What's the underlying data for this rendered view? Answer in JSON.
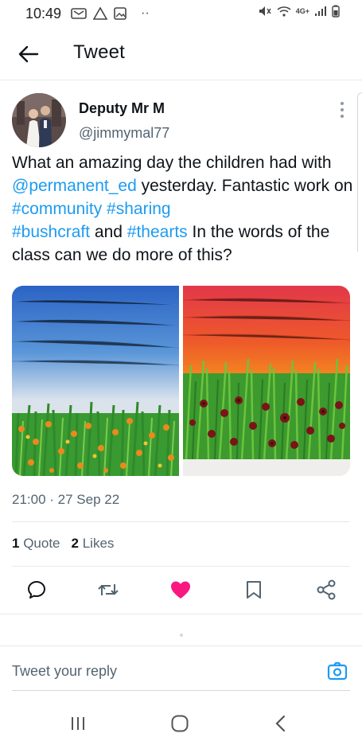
{
  "status_bar": {
    "time": "10:49",
    "dots": "··",
    "network": "4G+"
  },
  "header": {
    "title": "Tweet"
  },
  "tweet": {
    "display_name": "Deputy Mr M",
    "handle": "@jimmymal77",
    "text_parts": [
      "What an amazing day the children had with ",
      "@permanent_ed",
      " yesterday. Fantastic work on ",
      "#community",
      " ",
      "#sharing",
      " ",
      "#bushcraft",
      " and ",
      "#thearts",
      " In the words of the class can we do more of this?"
    ],
    "timestamp": "21:00 · 27 Sep 22",
    "stats": {
      "quotes_count": "1",
      "quotes_label": "Quote",
      "likes_count": "2",
      "likes_label": "Likes"
    },
    "liked": true
  },
  "reply": {
    "placeholder": "Tweet your reply"
  },
  "colors": {
    "link": "#1d9bf0",
    "like": "#f91880",
    "secondary_text": "#536471",
    "icon": "#536471"
  },
  "icons": {
    "back": "arrow-left-icon",
    "more": "more-vertical-icon",
    "reply": "comment-icon",
    "retweet": "retweet-icon",
    "like": "heart-icon",
    "bookmark": "bookmark-icon",
    "share": "share-icon",
    "camera": "camera-icon"
  }
}
